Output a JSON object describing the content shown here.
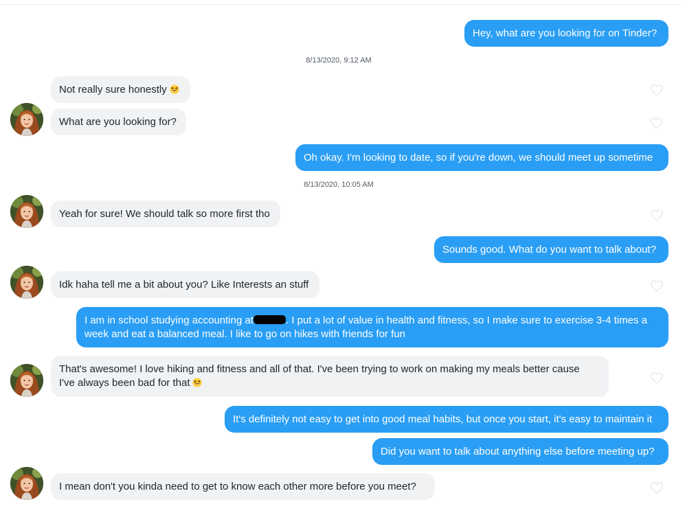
{
  "conversation": {
    "messages": [
      {
        "sender": "me",
        "text": "Hey, what are you looking for on Tinder?"
      },
      {
        "type": "timestamp",
        "text": "8/13/2020, 9:12 AM"
      },
      {
        "sender": "match",
        "text": "Not really sure honestly",
        "emoji": "grinning-squint-emoji"
      },
      {
        "sender": "match",
        "text": "What are you looking for?"
      },
      {
        "sender": "me",
        "text": "Oh okay. I'm looking to date, so if you're down, we should meet up sometime"
      },
      {
        "type": "timestamp",
        "text": "8/13/2020, 10:05 AM"
      },
      {
        "sender": "match",
        "text": "Yeah for sure! We should talk so more first tho"
      },
      {
        "sender": "me",
        "text": "Sounds good. What do you want to talk about?"
      },
      {
        "sender": "match",
        "text": "Idk haha tell me a bit about you? Like Interests an stuff"
      },
      {
        "sender": "me",
        "text_before": "I am in school studying accounting at",
        "text_after": ". I put a lot of value in health and fitness, so I make sure to exercise 3-4 times a week and eat a balanced meal. I like to go on hikes with friends for fun",
        "redacted": true
      },
      {
        "sender": "match",
        "text": "That's awesome! I love hiking and fitness and all of that. I've been trying to work on making my meals better cause I've always been bad for that",
        "emoji": "grinning-squint-emoji"
      },
      {
        "sender": "me",
        "text": "It's definitely not easy to get into good meal habits, but once you start, it's easy to maintain it"
      },
      {
        "sender": "me",
        "text": "Did you want to talk about anything else before meeting up?"
      },
      {
        "sender": "match",
        "text": "I mean don't you kinda need to get to know each other more before you meet?"
      }
    ]
  },
  "colors": {
    "outgoing_bubble": "#2a9ef4",
    "incoming_bubble": "#f0f2f4",
    "timestamp_text": "#505965",
    "heart_outline": "#e3e6ea"
  },
  "icons": {
    "like": "heart-outline-icon",
    "avatar": "match-avatar",
    "emoji": "grinning-squint-emoji"
  }
}
